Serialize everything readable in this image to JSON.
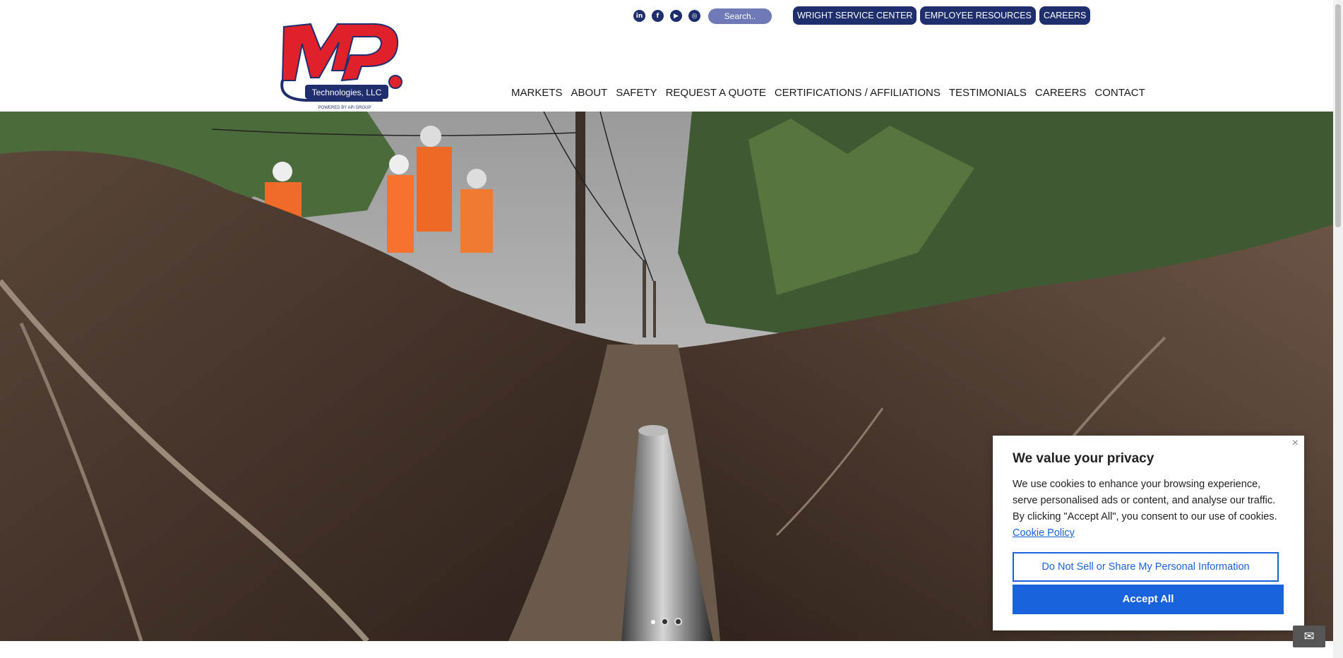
{
  "header": {
    "logo": {
      "main_text": "MP",
      "sub_text": "Technologies, LLC",
      "tagline": "POWERED BY APi GROUP"
    },
    "social_icons": [
      {
        "name": "linkedin-icon",
        "glyph": "in"
      },
      {
        "name": "facebook-icon",
        "glyph": "f"
      },
      {
        "name": "youtube-icon",
        "glyph": "▶"
      },
      {
        "name": "instagram-icon",
        "glyph": "◎"
      }
    ],
    "search": {
      "placeholder": "Search.."
    },
    "top_links": [
      "WRIGHT SERVICE CENTER",
      "EMPLOYEE RESOURCES",
      "CAREERS"
    ],
    "nav": [
      "MARKETS",
      "ABOUT",
      "SAFETY",
      "REQUEST A QUOTE",
      "CERTIFICATIONS / AFFILIATIONS",
      "TESTIMONIALS",
      "CAREERS",
      "CONTACT"
    ]
  },
  "hero": {
    "image": "trench-with-pipeline-and-workers-photo"
  },
  "cookie": {
    "title": "We value your privacy",
    "body": "We use cookies to enhance your browsing experience, serve personalised ads or content, and analyse our traffic. By clicking \"Accept All\", you consent to our use of cookies.",
    "link": "Cookie Policy",
    "close": "×",
    "reject_label": "Do Not Sell or Share My Personal Information",
    "accept_label": "Accept All"
  },
  "colors": {
    "brand_navy": "#1f2f6e",
    "brand_red": "#e0202a",
    "cookie_blue": "#1863dc"
  }
}
